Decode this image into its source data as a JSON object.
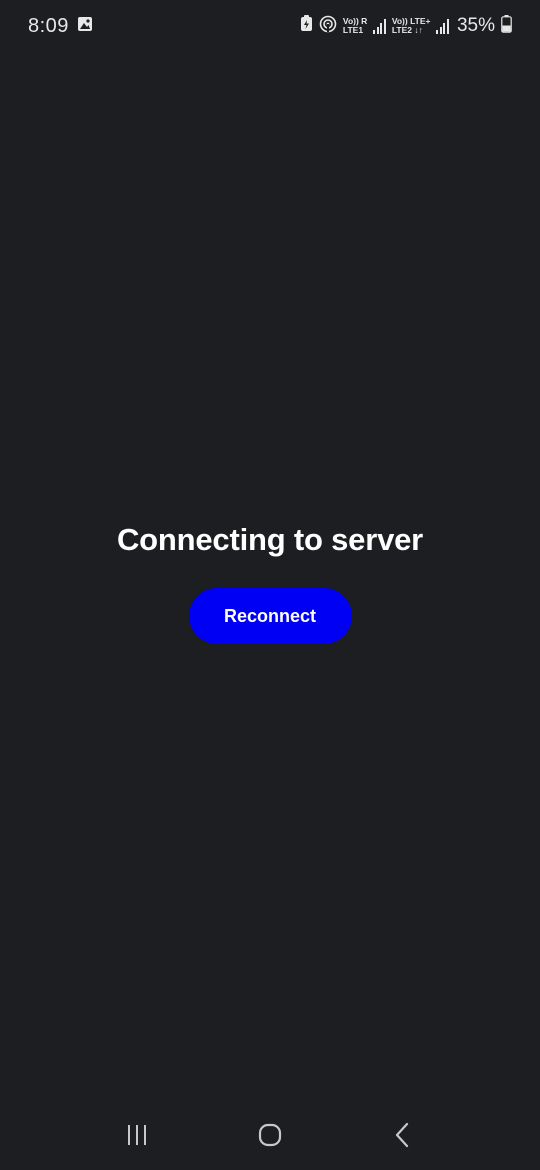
{
  "status_bar": {
    "time": "8:09",
    "sim1_top": "Vo)) R",
    "sim1_bottom": "LTE1",
    "sim2_top": "Vo)) LTE+",
    "sim2_bottom": "LTE2 ↓↑",
    "battery_percent": "35%",
    "icons": [
      "gallery-icon",
      "battery-saver-icon",
      "hotspot-icon",
      "signal-icon",
      "battery-icon"
    ]
  },
  "main": {
    "title": "Connecting to server",
    "reconnect_label": "Reconnect"
  },
  "colors": {
    "background": "#1c1e21",
    "button": "#0000f5",
    "text": "#ffffff"
  },
  "nav_bar": {
    "icons": [
      "recent-apps-icon",
      "home-icon",
      "back-icon"
    ]
  }
}
